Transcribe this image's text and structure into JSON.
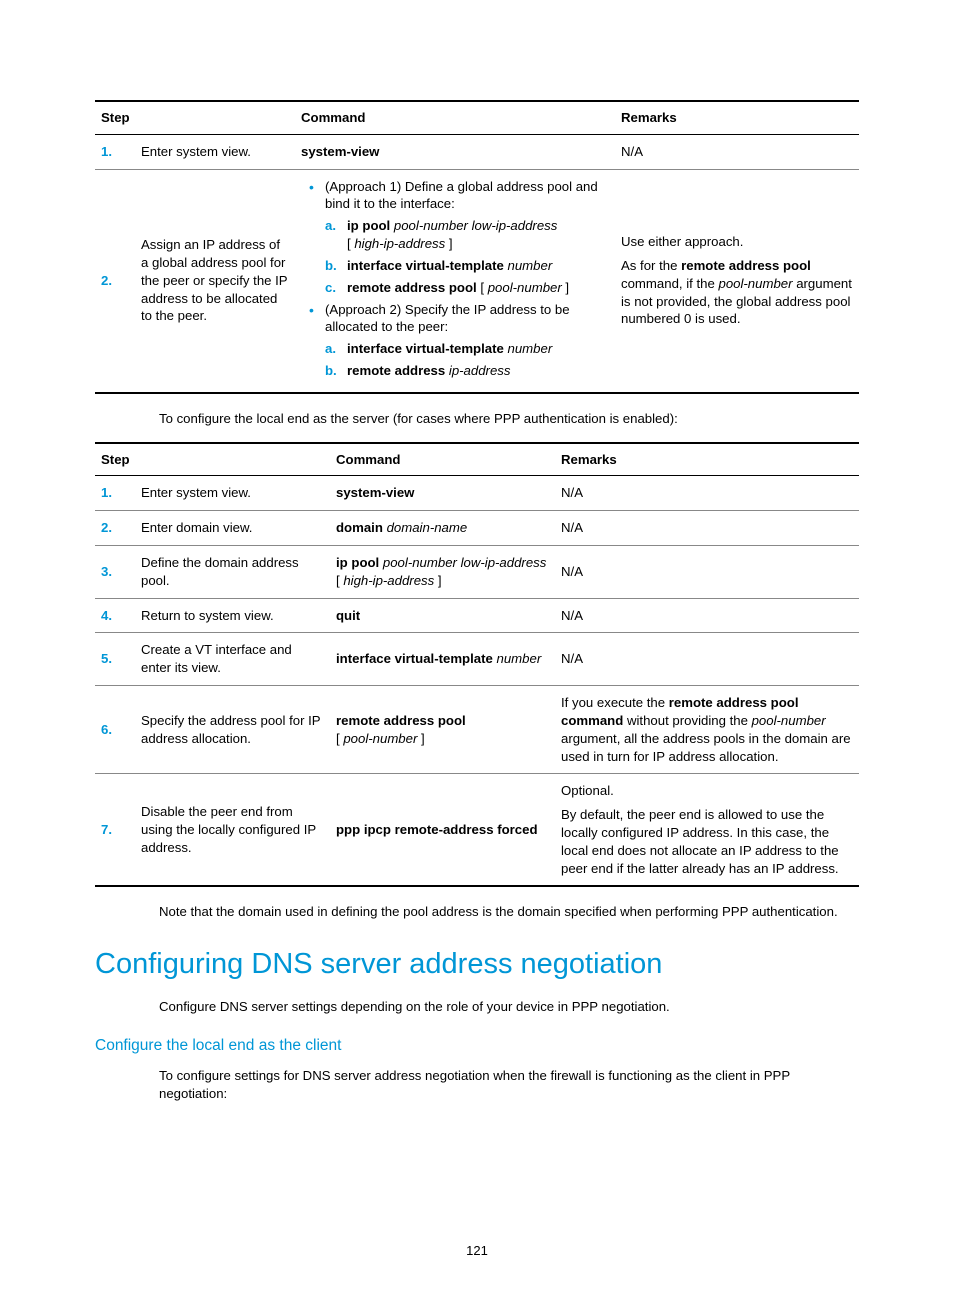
{
  "table1": {
    "headers": {
      "step": "Step",
      "command": "Command",
      "remarks": "Remarks"
    },
    "rows": [
      {
        "num": "1.",
        "desc": "Enter system view.",
        "cmd_bold": "system-view",
        "remarks": "N/A"
      }
    ],
    "row2": {
      "num": "2.",
      "desc": "Assign an IP address of a global address pool for the peer or specify the IP address to be allocated to the peer.",
      "approach1": "(Approach 1) Define a global address pool and bind it to the interface:",
      "a1_a_bold": "ip pool",
      "a1_a_ital1": "pool-number low-ip-address",
      "a1_a_ital2": "high-ip-address",
      "a1_b_bold": "interface virtual-template",
      "a1_b_ital": "number",
      "a1_c_bold": "remote address pool",
      "a1_c_ital": "pool-number",
      "approach2": "(Approach 2) Specify the IP address to be allocated to the peer:",
      "a2_a_bold": "interface virtual-template",
      "a2_a_ital": "number",
      "a2_b_bold": "remote address",
      "a2_b_ital": "ip-address",
      "rem_line1": "Use either approach.",
      "rem_pre": "As for the ",
      "rem_bold1": "remote address pool",
      "rem_mid1": " command, if the ",
      "rem_ital": "pool-number",
      "rem_post": " argument is not provided, the global address pool numbered 0 is used."
    }
  },
  "p1": "To configure the local end as the server (for cases where PPP authentication is enabled):",
  "table2": {
    "headers": {
      "step": "Step",
      "command": "Command",
      "remarks": "Remarks"
    },
    "r1": {
      "num": "1.",
      "desc": "Enter system view.",
      "cmd_bold": "system-view",
      "rem": "N/A"
    },
    "r2": {
      "num": "2.",
      "desc": "Enter domain view.",
      "cmd_bold": "domain",
      "cmd_ital": "domain-name",
      "rem": "N/A"
    },
    "r3": {
      "num": "3.",
      "desc": "Define the domain address pool.",
      "cmd_bold": "ip pool",
      "cmd_ital1": "pool-number low-ip-address",
      "cmd_ital2": "high-ip-address",
      "rem": "N/A"
    },
    "r4": {
      "num": "4.",
      "desc": "Return to system view.",
      "cmd_bold": "quit",
      "rem": "N/A"
    },
    "r5": {
      "num": "5.",
      "desc": "Create a VT interface and enter its view.",
      "cmd_bold": "interface virtual-template",
      "cmd_ital": "number",
      "rem": "N/A"
    },
    "r6": {
      "num": "6.",
      "desc": "Specify the address pool for IP address allocation.",
      "cmd_bold": "remote address pool",
      "cmd_ital": "pool-number",
      "rem_pre": "If you execute the ",
      "rem_bold": "remote address pool command",
      "rem_mid": " without providing the ",
      "rem_ital": "pool-number",
      "rem_post": " argument, all the address pools in the domain are used in turn for IP address allocation."
    },
    "r7": {
      "num": "7.",
      "desc": "Disable the peer end from using the locally configured IP address.",
      "cmd_bold": "ppp ipcp remote-address forced",
      "rem_opt": "Optional.",
      "rem_body": "By default, the peer end is allowed to use the locally configured IP address. In this case, the local end does not allocate an IP address to the peer end if the latter already has an IP address."
    }
  },
  "p2": "Note that the domain used in defining the pool address is the domain specified when performing PPP authentication.",
  "h1": "Configuring DNS server address negotiation",
  "p3": "Configure DNS server settings depending on the role of your device in PPP negotiation.",
  "h2": "Configure the local end as the client",
  "p4": "To configure settings for DNS server address negotiation when the firewall is functioning as the client in PPP negotiation:",
  "pagenum": "121"
}
